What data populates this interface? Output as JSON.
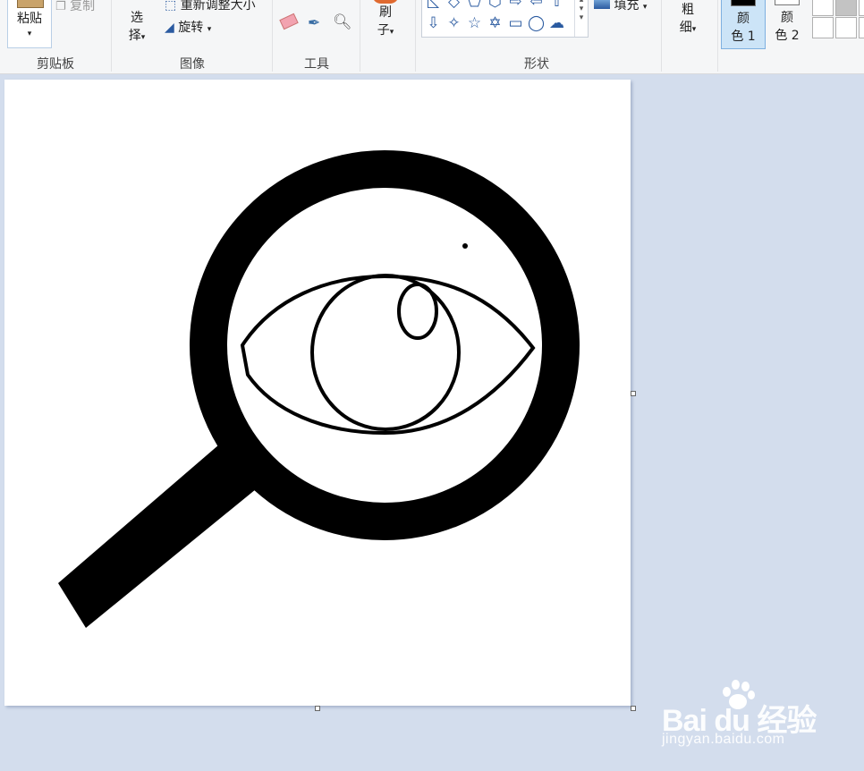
{
  "clipboard": {
    "paste_label": "粘贴",
    "copy_label": "复制",
    "group_label": "剪贴板"
  },
  "image": {
    "select_label_1": "选",
    "select_label_2": "择",
    "resize_label": "重新调整大小",
    "rotate_label": "旋转",
    "group_label": "图像"
  },
  "tools": {
    "group_label": "工具"
  },
  "brushes": {
    "label_1": "刷",
    "label_2": "子"
  },
  "shapes": {
    "row1": [
      "◺",
      "◇",
      "⬠",
      "⬡",
      "⇨",
      "⇦",
      "⇧"
    ],
    "row2": [
      "⇩",
      "✧",
      "☆",
      "✡",
      "▭",
      "◯",
      "☁"
    ],
    "fill_label": "填充",
    "group_label": "形状"
  },
  "size": {
    "label_1": "粗",
    "label_2": "细"
  },
  "colors": {
    "color1_label_1": "颜",
    "color1_label_2": "色 1",
    "color2_label_1": "颜",
    "color2_label_2": "色 2",
    "color1_value": "#000000",
    "color2_value": "#ffffff",
    "palette": [
      "#ffffff",
      "#c3c3c3",
      "#ffffff",
      "#ffffff",
      "#ffffff",
      "#ffffff"
    ]
  },
  "watermark": {
    "brand": "Bai  du 经验",
    "url": "jingyan.baidu.com"
  }
}
